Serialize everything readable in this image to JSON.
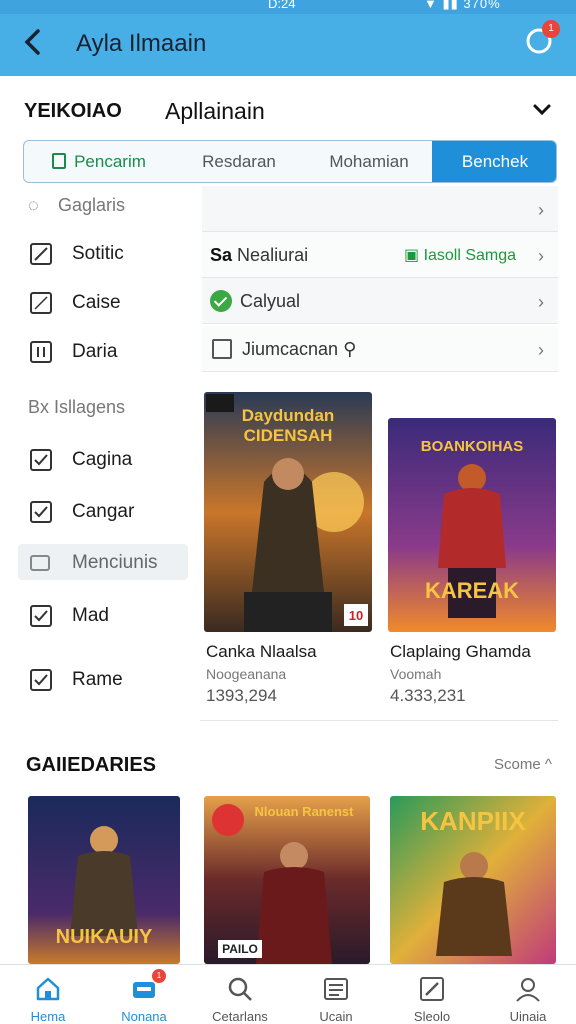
{
  "status_bar": {
    "time": "D:24",
    "battery": "370%"
  },
  "app_bar": {
    "title": "Ayla Ilmaain",
    "notification_count": "1"
  },
  "section": {
    "title_left": "YEIKOIAO",
    "title_right": "Apllainain"
  },
  "tabs": [
    {
      "label": "Pencarim"
    },
    {
      "label": "Resdaran"
    },
    {
      "label": "Mohamian"
    },
    {
      "label": "Benchek"
    }
  ],
  "left_list": {
    "group1": "Gaglaris",
    "items1": [
      {
        "label": "Sotitic"
      },
      {
        "label": "Caise"
      },
      {
        "label": "Daria"
      }
    ],
    "group2": "Isllagens",
    "group2_prefix": "Bx",
    "items2": [
      {
        "label": "Cagina"
      },
      {
        "label": "Cangar"
      }
    ],
    "highlight": "Menciunis",
    "items3": [
      {
        "label": "Mad"
      },
      {
        "label": "Rame"
      }
    ]
  },
  "right_rows": {
    "row2_bold": "Sa",
    "row2_label": "Nealiurai",
    "row2_accent": "Iasoll Samga",
    "row3_label": "Calyual",
    "row4_label": "Jiumcacnan"
  },
  "cards_top": [
    {
      "banner": "Daydundan CIDENSAH",
      "name": "Canka Nlaalsa",
      "sub": "Noogeanana",
      "num": "1393,294",
      "corner": "10"
    },
    {
      "banner": "BOANKOIHAS",
      "banner2": "KAREAK",
      "name": "Claplaing Ghamda",
      "sub": "Voomah",
      "num": "4.333,231"
    }
  ],
  "section2": {
    "title": "GAIIEDARIES",
    "more": "Scome"
  },
  "cards_bottom": [
    {
      "banner": "NUIKAUIY"
    },
    {
      "banner": "Nlouan Ranenst",
      "tag": "PAILO"
    },
    {
      "banner": "KANPIIX"
    }
  ],
  "bottom_nav": [
    {
      "label": "Hema",
      "icon": "home-icon"
    },
    {
      "label": "Nonana",
      "icon": "library-icon",
      "badge": "1"
    },
    {
      "label": "Cetarlans",
      "icon": "search-icon"
    },
    {
      "label": "Ucain",
      "icon": "list-icon"
    },
    {
      "label": "Sleolo",
      "icon": "edit-icon"
    },
    {
      "label": "Uinaia",
      "icon": "profile-icon"
    }
  ],
  "colors": {
    "app_bar": "#47aee6",
    "tab_active": "#1f8fd9",
    "accent_green": "#1b9a3c",
    "badge": "#e8453c"
  }
}
